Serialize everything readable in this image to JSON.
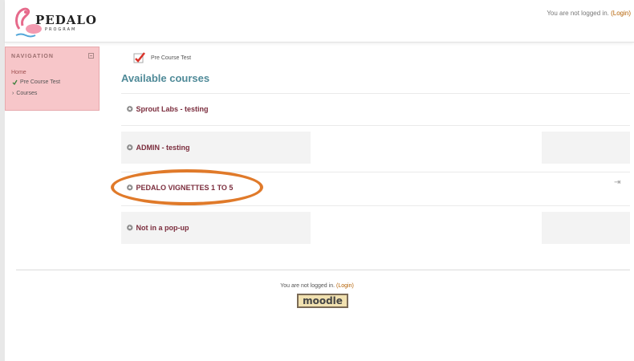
{
  "header": {
    "logo_text": "PEDALO",
    "logo_sub": "PROGRAM",
    "login_prefix": "You are not logged in.",
    "login_link": "(Login)"
  },
  "navigation": {
    "title": "NAVIGATION",
    "home": "Home",
    "items": [
      {
        "label": "Pre Course Test",
        "icon": "check-icon"
      },
      {
        "label": "Courses",
        "icon": "chevron-right-icon"
      }
    ]
  },
  "main": {
    "breadcrumb_label": "Pre Course Test",
    "section_title": "Available courses",
    "courses": [
      {
        "label": "Sprout Labs - testing"
      },
      {
        "label": "ADMIN - testing"
      },
      {
        "label": "PEDALO VIGNETTES 1 TO 5"
      },
      {
        "label": "Not in a pop-up"
      }
    ]
  },
  "footer": {
    "login_prefix": "You are not logged in.",
    "login_link": "(Login)",
    "logo_text": "moodle"
  },
  "colors": {
    "nav_bg": "#f7c6c9",
    "course_link": "#7b2d3d",
    "section_title": "#4f8a98",
    "highlight": "#e07a2a"
  }
}
